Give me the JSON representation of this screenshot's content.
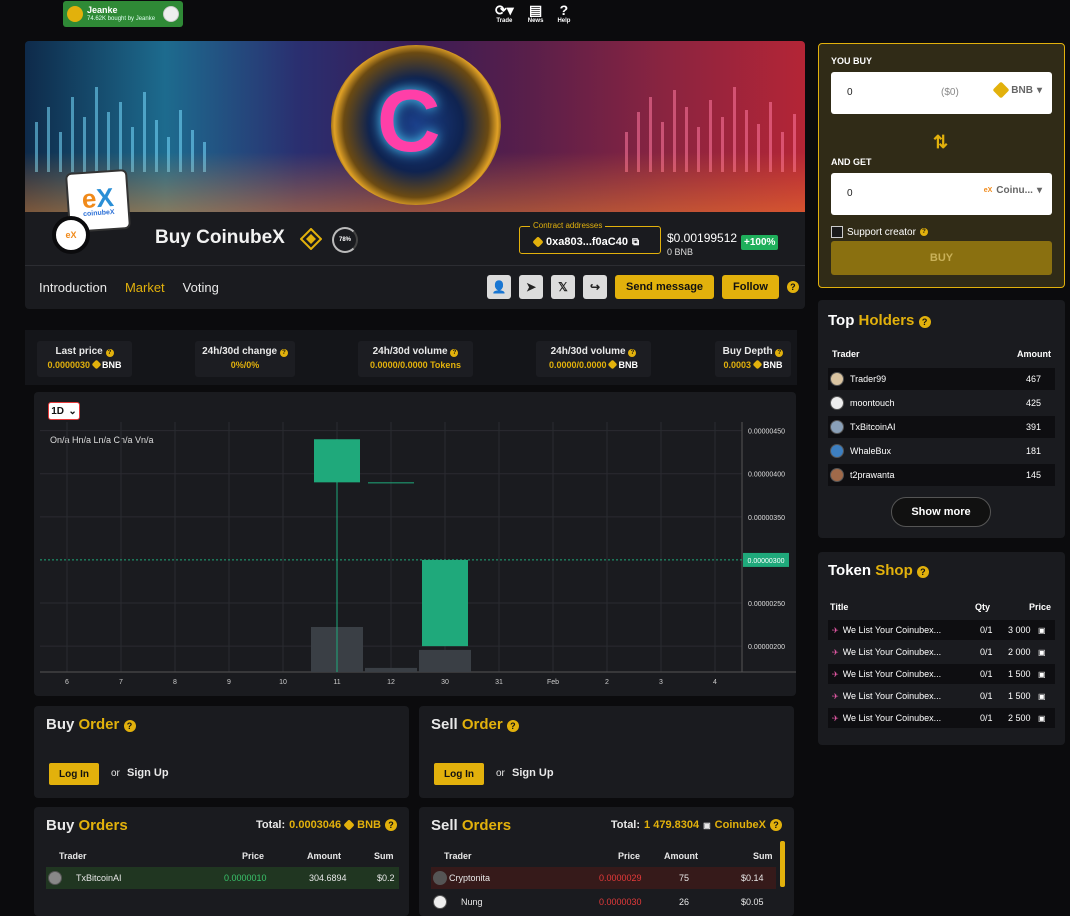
{
  "notification": {
    "name": "Jeanke",
    "detail": "74.62K bought by Jeanke"
  },
  "topnav": [
    {
      "label": "Trade",
      "icon": "refresh-icon"
    },
    {
      "label": "News",
      "icon": "news-icon"
    },
    {
      "label": "Help",
      "icon": "help-icon"
    }
  ],
  "token": {
    "title": "Buy CoinubeX",
    "logo_text": "coinubeX",
    "progress": "78%",
    "contract_label": "Contract addresses",
    "contract": "0xa803...f0aC40",
    "price": "$0.00199512",
    "price_bnb": "0 BNB",
    "change": "+100%"
  },
  "tabs": [
    "Introduction",
    "Market",
    "Voting"
  ],
  "actions": {
    "send": "Send message",
    "follow": "Follow"
  },
  "stats": [
    {
      "label": "Last price",
      "value": "0.0000030",
      "unit": "BNB"
    },
    {
      "label": "24h/30d change",
      "value": "0%/0%",
      "unit": ""
    },
    {
      "label": "24h/30d volume",
      "value": "0.0000/0.0000 Tokens",
      "unit": ""
    },
    {
      "label": "24h/30d volume",
      "value": "0.0000/0.0000",
      "unit": "BNB"
    },
    {
      "label": "Buy Depth",
      "value": "0.0003",
      "unit": "BNB"
    }
  ],
  "chart_data": {
    "type": "candlestick",
    "timeframe": "1D",
    "ohlc_legend": "On/a Hn/a Ln/a Cn/a Vn/a",
    "x_ticks": [
      "6",
      "7",
      "8",
      "9",
      "10",
      "11",
      "12",
      "30",
      "31",
      "Feb",
      "2",
      "3",
      "4"
    ],
    "y_ticks": [
      "0.00000450",
      "0.00000400",
      "0.00000350",
      "0.00000250",
      "0.00000200"
    ],
    "ylim": [
      1.7e-06,
      4.6e-06
    ],
    "last_price_label": "0.00000300",
    "last_price": 3e-06,
    "candles": [
      {
        "x": "11",
        "open": 4.4e-06,
        "close": 3.9e-06,
        "high": 4.4e-06,
        "low": 1.3e-06,
        "color": "#1fa97b",
        "volume": 0.55
      },
      {
        "x": "12",
        "open": 3.9e-06,
        "close": 3.9e-06,
        "high": 3.9e-06,
        "low": 3.9e-06,
        "color": "#1fa97b",
        "volume": 0.05
      },
      {
        "x": "30",
        "open": 2e-06,
        "close": 3e-06,
        "high": 3e-06,
        "low": 2e-06,
        "color": "#1fa97b",
        "volume": 0.27
      }
    ]
  },
  "swap": {
    "you_buy": "YOU BUY",
    "buy_amount": "0",
    "buy_usd": "($0)",
    "buy_token": "BNB",
    "and_get": "AND GET",
    "get_amount": "0",
    "get_token": "Coinu...",
    "support": "Support creator",
    "button": "BUY"
  },
  "holders": {
    "title_a": "Top",
    "title_b": "Holders",
    "col_trader": "Trader",
    "col_amount": "Amount",
    "rows": [
      {
        "name": "Trader99",
        "amount": "467"
      },
      {
        "name": "moontouch",
        "amount": "425"
      },
      {
        "name": "TxBitcoinAI",
        "amount": "391"
      },
      {
        "name": "WhaleBux",
        "amount": "181"
      },
      {
        "name": "t2prawanta",
        "amount": "145"
      }
    ],
    "show_more": "Show more"
  },
  "shop": {
    "title_a": "Token",
    "title_b": "Shop",
    "col_title": "Title",
    "col_qty": "Qty",
    "col_price": "Price",
    "rows": [
      {
        "title": "We List Your Coinubex...",
        "qty": "0/1",
        "price": "3 000"
      },
      {
        "title": "We List Your Coinubex...",
        "qty": "0/1",
        "price": "2 000"
      },
      {
        "title": "We List Your Coinubex...",
        "qty": "0/1",
        "price": "1 500"
      },
      {
        "title": "We List Your Coinubex...",
        "qty": "0/1",
        "price": "1 500"
      },
      {
        "title": "We List Your Coinubex...",
        "qty": "0/1",
        "price": "2 500"
      }
    ]
  },
  "buy_order": {
    "title_a": "Buy",
    "title_b": "Order",
    "login": "Log In",
    "or": "or",
    "signup": "Sign Up"
  },
  "sell_order": {
    "title_a": "Sell",
    "title_b": "Order",
    "login": "Log In",
    "or": "or",
    "signup": "Sign Up"
  },
  "buy_orders": {
    "title_a": "Buy",
    "title_b": "Orders",
    "total_label": "Total:",
    "total": "0.0003046",
    "unit": "BNB",
    "cols": [
      "Trader",
      "Price",
      "Amount",
      "Sum"
    ],
    "rows": [
      {
        "trader": "TxBitcoinAI",
        "price": "0.0000010",
        "amount": "304.6894",
        "sum": "$0.2"
      }
    ]
  },
  "sell_orders": {
    "title_a": "Sell",
    "title_b": "Orders",
    "total_label": "Total:",
    "total": "1 479.8304",
    "unit": "CoinubeX",
    "cols": [
      "Trader",
      "Price",
      "Amount",
      "Sum"
    ],
    "rows": [
      {
        "trader": "Cryptonita",
        "price": "0.0000029",
        "amount": "75",
        "sum": "$0.14"
      },
      {
        "trader": "Nung",
        "price": "0.0000030",
        "amount": "26",
        "sum": "$0.05"
      }
    ]
  }
}
